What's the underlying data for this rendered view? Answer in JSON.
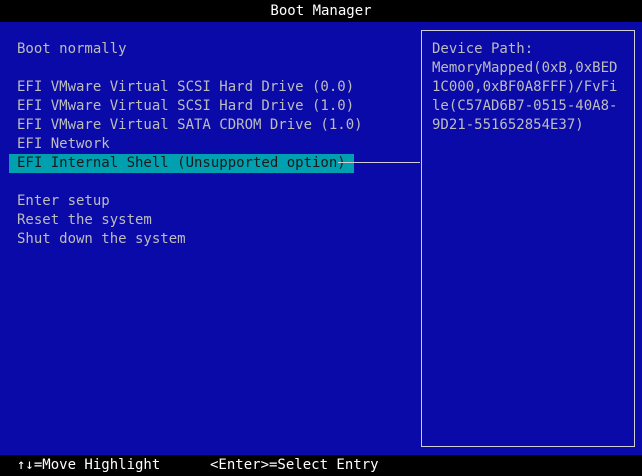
{
  "window": {
    "title": "Boot Manager"
  },
  "menu": {
    "items": [
      {
        "label": "Boot normally",
        "selected": false
      },
      {
        "label": "EFI VMware Virtual SCSI Hard Drive (0.0)",
        "selected": false
      },
      {
        "label": "EFI VMware Virtual SCSI Hard Drive (1.0)",
        "selected": false
      },
      {
        "label": "EFI VMware Virtual SATA CDROM Drive (1.0)",
        "selected": false
      },
      {
        "label": "EFI Network",
        "selected": false
      },
      {
        "label": "EFI Internal Shell (Unsupported option)",
        "selected": true
      },
      {
        "label": "Enter setup",
        "selected": false
      },
      {
        "label": "Reset the system",
        "selected": false
      },
      {
        "label": "Shut down the system",
        "selected": false
      }
    ]
  },
  "info_panel": {
    "heading": "Device Path:",
    "value": "MemoryMapped(0xB,0xBED1C000,0xBF0A8FFF)/FvFile(C57AD6B7-0515-40A8-9D21-551652854E37)"
  },
  "statusbar": {
    "move_hint": "↑↓=Move Highlight",
    "select_hint": "<Enter>=Select Entry"
  },
  "colors": {
    "background": "#0a0aa8",
    "highlight": "#00a0b0",
    "text": "#bdbdbd",
    "bar": "#000000"
  }
}
